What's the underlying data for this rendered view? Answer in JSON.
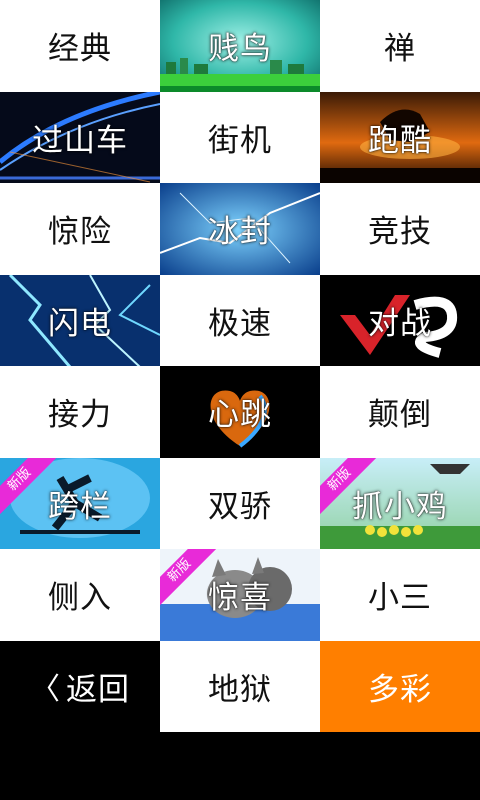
{
  "tiles": [
    {
      "label": "经典",
      "style": "white"
    },
    {
      "label": "贱鸟",
      "style": "img",
      "scene": "teal-city"
    },
    {
      "label": "禅",
      "style": "white"
    },
    {
      "label": "过山车",
      "style": "img",
      "scene": "bridge-night"
    },
    {
      "label": "街机",
      "style": "white"
    },
    {
      "label": "跑酷",
      "style": "img",
      "scene": "sunset-horse"
    },
    {
      "label": "惊险",
      "style": "white"
    },
    {
      "label": "冰封",
      "style": "img",
      "scene": "ice-crack"
    },
    {
      "label": "竞技",
      "style": "white"
    },
    {
      "label": "闪电",
      "style": "img",
      "scene": "lightning"
    },
    {
      "label": "极速",
      "style": "white"
    },
    {
      "label": "对战",
      "style": "img",
      "scene": "vs-logo"
    },
    {
      "label": "接力",
      "style": "white"
    },
    {
      "label": "心跳",
      "style": "img",
      "scene": "fire-heart"
    },
    {
      "label": "颠倒",
      "style": "white"
    },
    {
      "label": "跨栏",
      "style": "img",
      "scene": "hurdle",
      "badge": "新版"
    },
    {
      "label": "双骄",
      "style": "white"
    },
    {
      "label": "抓小鸡",
      "style": "img",
      "scene": "chicks",
      "badge": "新版"
    },
    {
      "label": "侧入",
      "style": "white"
    },
    {
      "label": "惊喜",
      "style": "img",
      "scene": "kittens",
      "badge": "新版"
    },
    {
      "label": "小三",
      "style": "white"
    },
    {
      "label": "返回",
      "style": "black",
      "icon": "back-chevron-icon",
      "glyph": "〈"
    },
    {
      "label": "地狱",
      "style": "white"
    },
    {
      "label": "多彩",
      "style": "orange"
    }
  ],
  "colors": {
    "badge": "#e82ad8",
    "accent": "#ff7f00"
  }
}
